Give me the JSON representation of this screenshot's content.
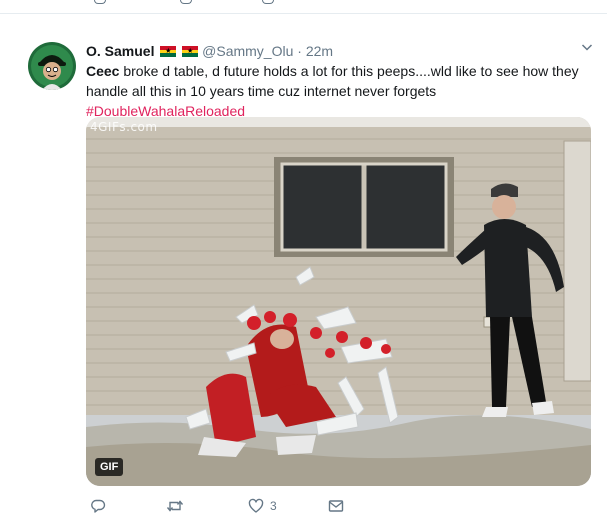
{
  "tweet": {
    "author_name": "O. Samuel",
    "handle": "@Sammy_Olu",
    "separator": "·",
    "time": "22m",
    "text_bold": "Ceec",
    "text_rest": " broke d table, d future holds a lot for this peeps....wld like to see how they handle all this in 10 years time cuz internet never forgets",
    "hashtag": "#DoubleWahalaReloaded",
    "media": {
      "watermark": "4GIFs.com",
      "badge": "GIF"
    },
    "actions": {
      "reply_count": "",
      "retweet_count": "",
      "like_count": "3"
    }
  },
  "colors": {
    "text": "#14171a",
    "muted": "#657786",
    "hashtag": "#e0245e",
    "divider": "#e6ecf0"
  },
  "icons": [
    "reply-icon",
    "retweet-icon",
    "like-icon",
    "message-icon",
    "chevron-down-icon"
  ]
}
